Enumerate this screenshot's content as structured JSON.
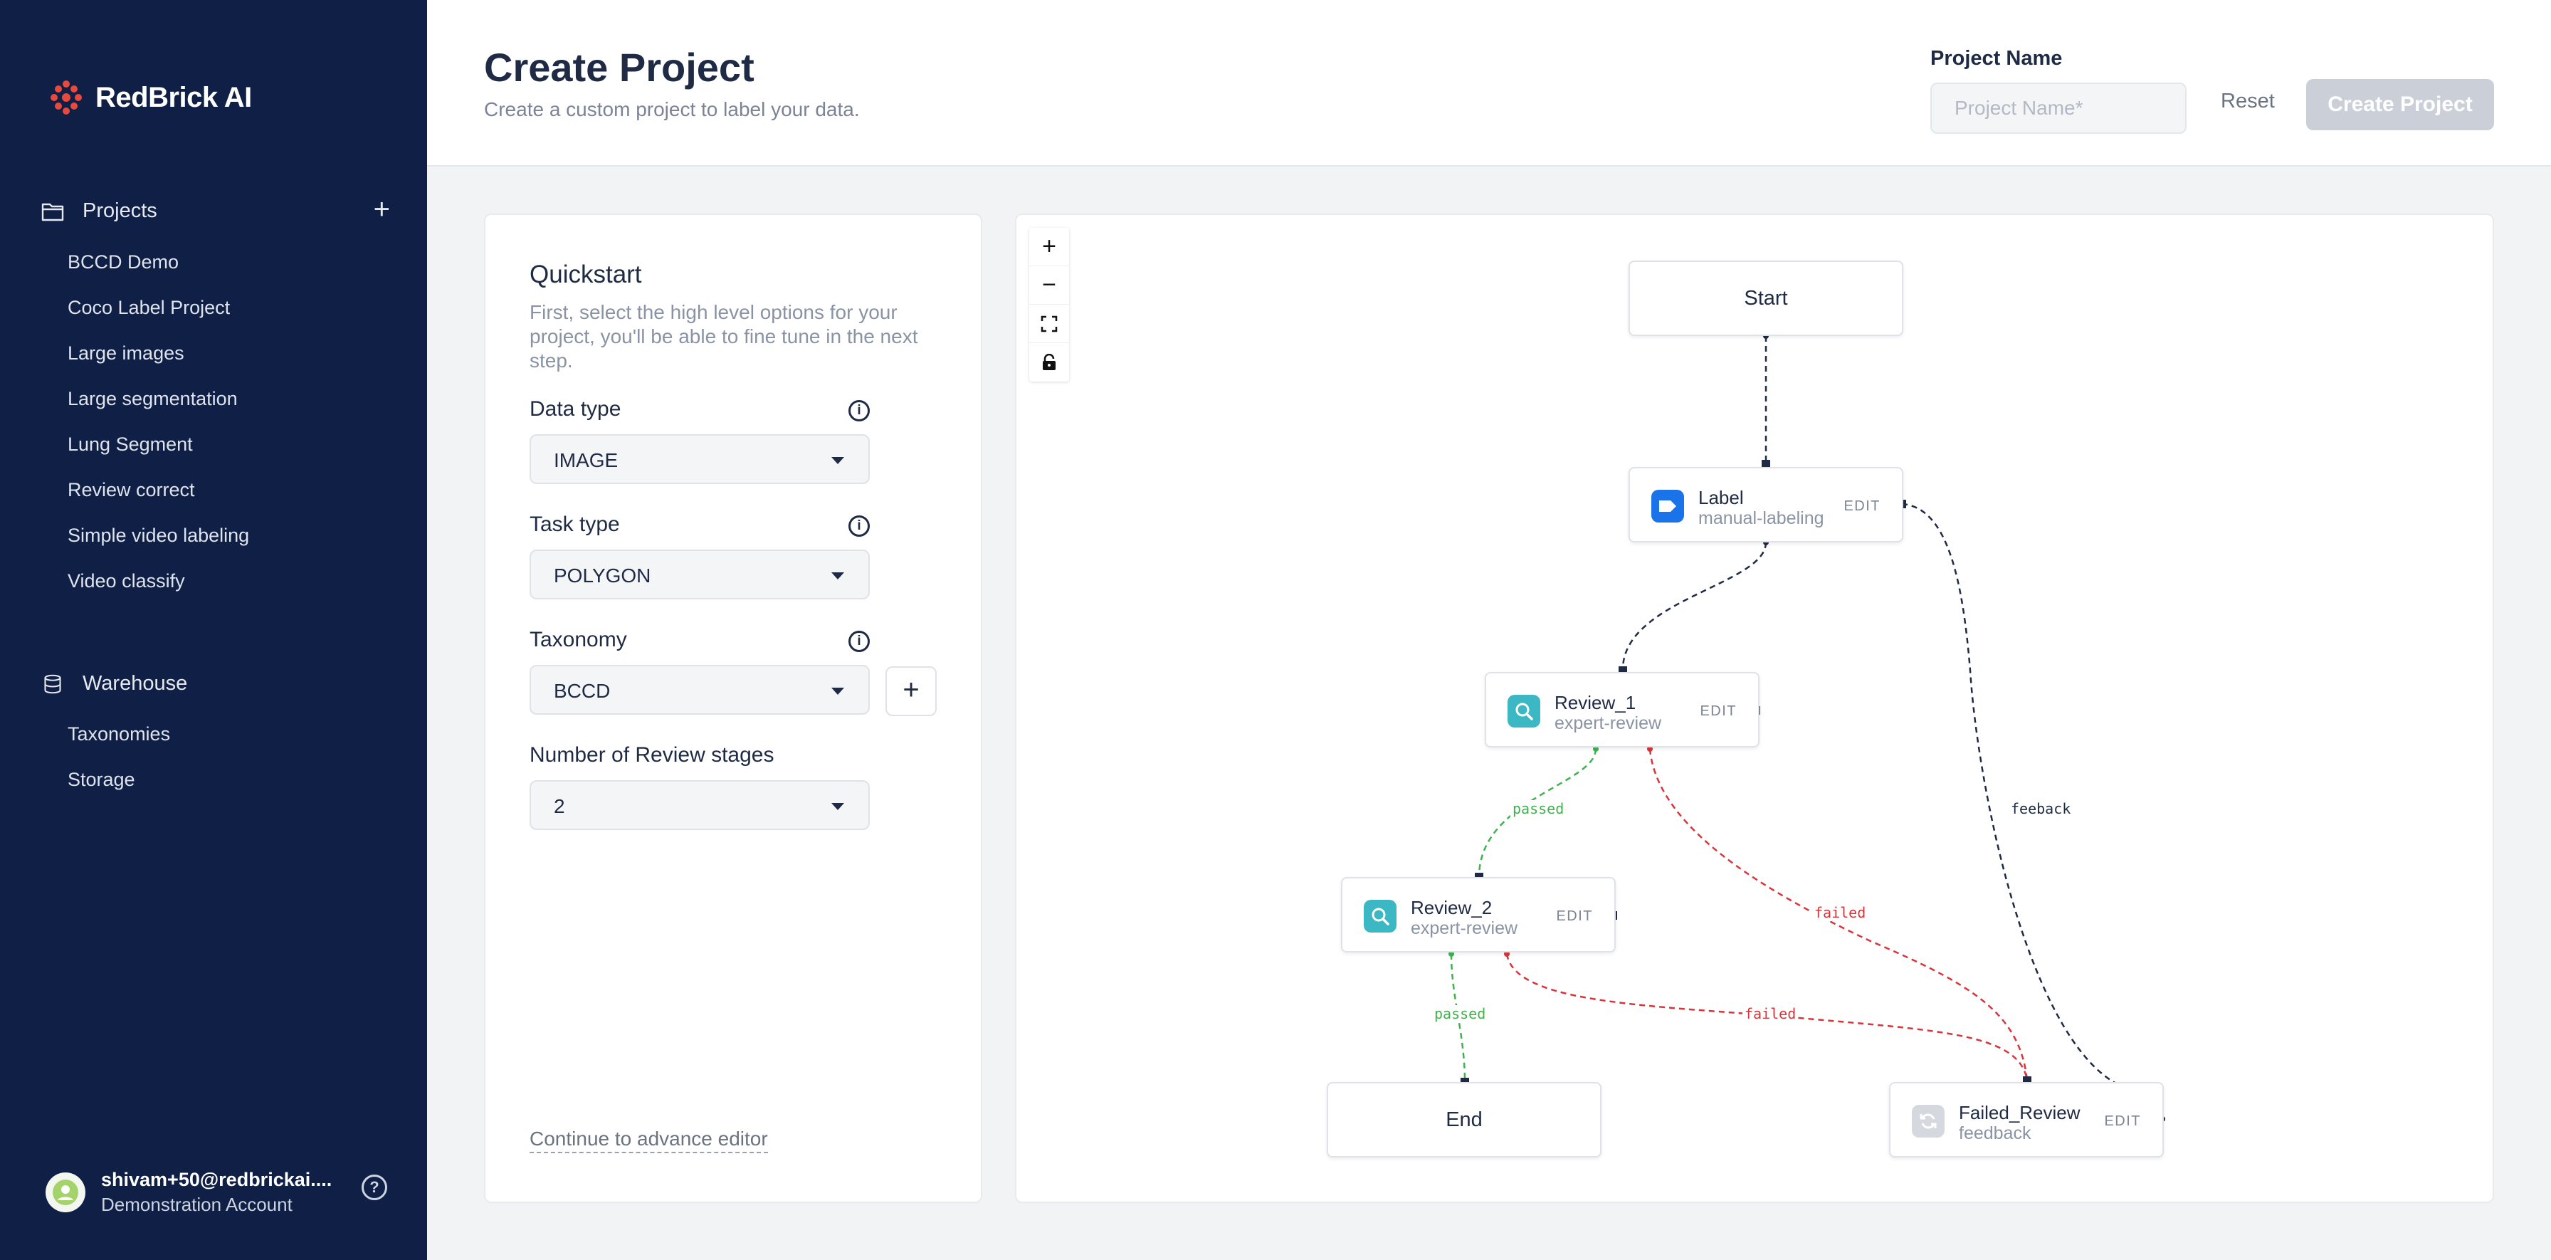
{
  "sidebar": {
    "logo_text": "RedBrick AI",
    "projects_label": "Projects",
    "projects": [
      "BCCD Demo",
      "Coco Label Project",
      "Large images",
      "Large segmentation",
      "Lung Segment",
      "Review correct",
      "Simple video labeling",
      "Video classify"
    ],
    "warehouse_label": "Warehouse",
    "warehouse_items": [
      "Taxonomies",
      "Storage"
    ],
    "user": {
      "email": "shivam+50@redbrickai....",
      "account": "Demonstration Account"
    }
  },
  "header": {
    "title": "Create Project",
    "subtitle": "Create a custom project to label your data.",
    "project_name_label": "Project Name",
    "project_name_placeholder": "Project Name*",
    "project_name_value": "",
    "reset_label": "Reset",
    "create_label": "Create Project"
  },
  "quickstart": {
    "title": "Quickstart",
    "description": "First, select the high level options for your project, you'll be able to fine tune in the next step.",
    "data_type_label": "Data type",
    "data_type_value": "IMAGE",
    "task_type_label": "Task type",
    "task_type_value": "POLYGON",
    "taxonomy_label": "Taxonomy",
    "taxonomy_value": "BCCD",
    "review_stages_label": "Number of Review stages",
    "review_stages_value": "2",
    "advance_link": "Continue to advance editor"
  },
  "workflow": {
    "start": "Start",
    "end": "End",
    "edit_label": "EDIT",
    "label_node": {
      "title": "Label",
      "subtitle": "manual-labeling"
    },
    "review1_node": {
      "title": "Review_1",
      "subtitle": "expert-review"
    },
    "review2_node": {
      "title": "Review_2",
      "subtitle": "expert-review"
    },
    "failed_node": {
      "title": "Failed_Review",
      "subtitle": "feedback"
    },
    "edges": {
      "r1_passed": "passed",
      "r1_failed": "failed",
      "r2_passed": "passed",
      "r2_failed": "failed",
      "feedback": "feeback"
    }
  },
  "colors": {
    "sidebar_bg": "#0f1f45",
    "passed": "#3fb24e",
    "failed": "#d9343a",
    "edge_default": "#1f2a44",
    "label_icon": "#1a73e8",
    "review_icon": "#3bb8c4"
  }
}
